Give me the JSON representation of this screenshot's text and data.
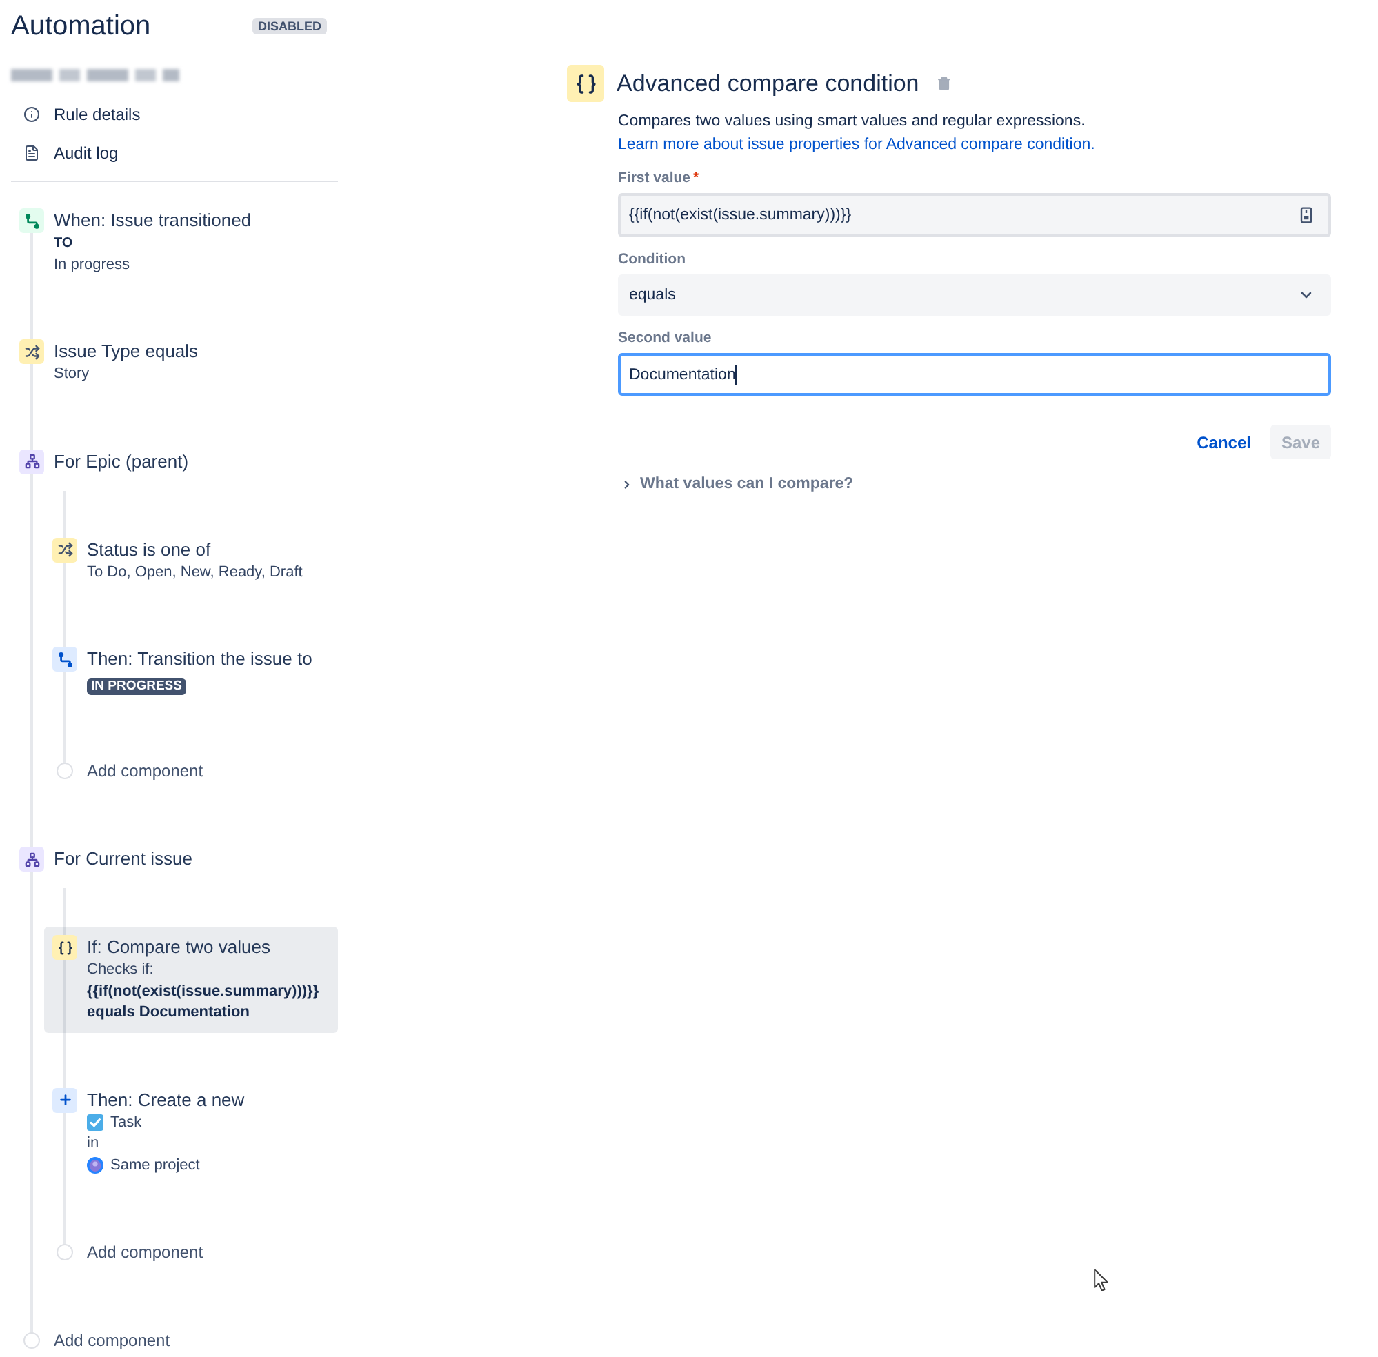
{
  "header": {
    "title": "Automation",
    "status_badge": "DISABLED"
  },
  "rule_name": {
    "blurred": true
  },
  "menu": [
    {
      "kind": "details",
      "label": "Rule details"
    },
    {
      "kind": "audit",
      "label": "Audit log"
    }
  ],
  "rule": {
    "components": [
      {
        "kind": "trigger",
        "title": "When: Issue transitioned",
        "selected": false,
        "lines": [
          {
            "kind": "caption",
            "text": "TO"
          },
          {
            "kind": "text",
            "text": "In progress"
          }
        ]
      },
      {
        "kind": "condition",
        "title": "Issue Type equals",
        "selected": false,
        "lines": [
          {
            "kind": "text",
            "text": "Story"
          }
        ]
      },
      {
        "kind": "branch",
        "title": "For Epic (parent)",
        "selected": false,
        "children": [
          {
            "kind": "condition",
            "title": "Status is one of",
            "selected": false,
            "lines": [
              {
                "kind": "text",
                "text": "To Do, Open, New, Ready, Draft"
              }
            ]
          },
          {
            "kind": "transition",
            "title": "Then: Transition the issue to",
            "selected": false,
            "lines": [
              {
                "kind": "lozenge",
                "text": "IN PROGRESS"
              }
            ]
          },
          {
            "kind": "add",
            "title": "Add component",
            "selected": false
          }
        ]
      },
      {
        "kind": "branch",
        "title": "For Current issue",
        "selected": false,
        "children": [
          {
            "kind": "compare",
            "title": "If: Compare two values",
            "selected": true,
            "lines": [
              {
                "kind": "text",
                "text": "Checks if:"
              },
              {
                "kind": "code",
                "text": "{{if(not(exist(issue.summary)))}}"
              },
              {
                "kind": "code",
                "text": "equals Documentation"
              }
            ]
          },
          {
            "kind": "create",
            "title": "Then: Create a new",
            "selected": false,
            "lines": [
              {
                "kind": "issue_type",
                "text": "Task"
              },
              {
                "kind": "text",
                "text": "in"
              },
              {
                "kind": "project",
                "text": "Same project"
              }
            ]
          },
          {
            "kind": "add",
            "title": "Add component",
            "selected": false
          }
        ]
      },
      {
        "kind": "add",
        "title": "Add component",
        "selected": false
      }
    ]
  },
  "editor": {
    "title": "Advanced compare condition",
    "description": "Compares two values using smart values and regular expressions.",
    "link": "Learn more about issue properties for Advanced compare condition.",
    "fields": [
      {
        "kind": "smart",
        "label": "First value",
        "required_mark": "*",
        "value": "{{if(not(exist(issue.summary)))}}",
        "focused": false
      },
      {
        "kind": "select",
        "label": "Condition",
        "value": "equals",
        "focused": false
      },
      {
        "kind": "text",
        "label": "Second value",
        "value": "Documentation",
        "focused": true
      }
    ],
    "buttons": [
      {
        "kind": "subtle",
        "label": "Cancel",
        "disabled": false
      },
      {
        "kind": "primary",
        "label": "Save",
        "disabled": true
      }
    ],
    "expander": {
      "label": "What values can I compare?",
      "expanded": false
    }
  },
  "mouse_cursor": {
    "visible": true
  }
}
